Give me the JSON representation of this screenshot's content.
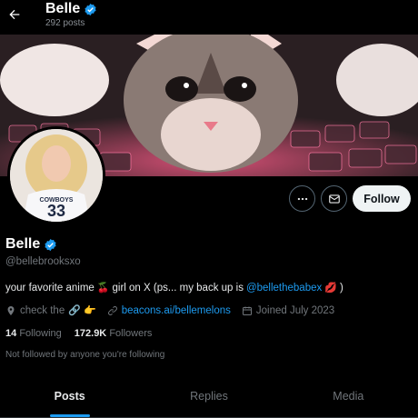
{
  "header": {
    "name": "Belle",
    "posts_count": "292 posts"
  },
  "profile": {
    "name": "Belle",
    "handle": "@bellebrooksxo",
    "avatar_shirt_text": "COWBOYS",
    "avatar_shirt_number": "33"
  },
  "actions": {
    "follow_label": "Follow"
  },
  "bio": {
    "part1": "your favorite anime",
    "emoji1": "🍒",
    "part2": "girl on X (ps... my back up is",
    "mention": "@bellethebabex",
    "emoji2": "💋",
    "part3": ")"
  },
  "meta": {
    "location": "check the",
    "location_emoji": "🔗 👉",
    "website": "beacons.ai/bellemelons",
    "joined": "Joined July 2023"
  },
  "stats": {
    "following_count": "14",
    "following_label": "Following",
    "followers_count": "172.9K",
    "followers_label": "Followers"
  },
  "followed_by": "Not followed by anyone you're following",
  "tabs": [
    {
      "label": "Posts",
      "active": true
    },
    {
      "label": "Replies",
      "active": false
    },
    {
      "label": "Media",
      "active": false
    }
  ],
  "colors": {
    "accent": "#1d9bf0",
    "background": "#000000",
    "follow_button": "#eff3f4",
    "verified": "#1d9bf0"
  },
  "icons": {
    "back": "arrow-left-icon",
    "verified": "verified-badge-icon",
    "more": "more-horizontal-icon",
    "message": "envelope-icon",
    "location": "location-pin-icon",
    "link": "link-icon",
    "calendar": "calendar-icon"
  }
}
